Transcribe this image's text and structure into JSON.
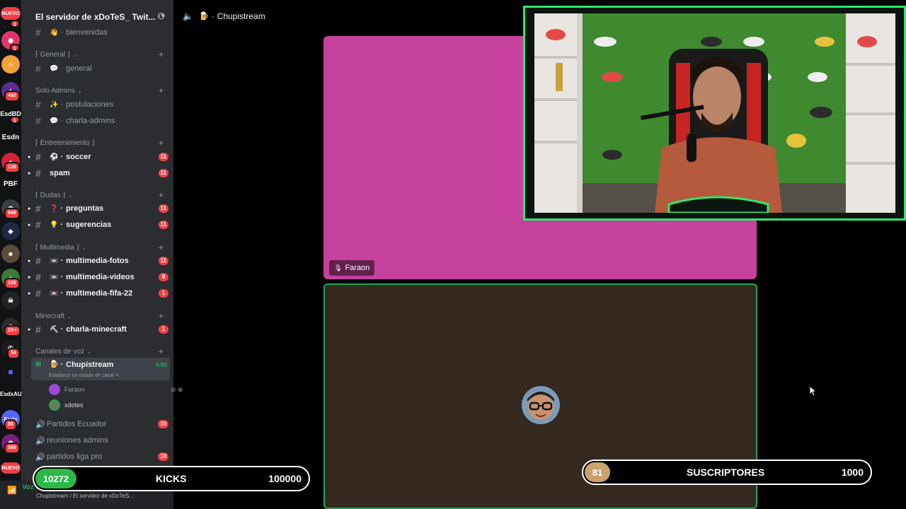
{
  "server_rail": {
    "nuevo_top": "NUEVO",
    "badges": [
      "1",
      "1",
      "480",
      "1",
      "136",
      "949",
      "106",
      "1K+",
      "34",
      "86",
      "389"
    ],
    "labels": [
      "EsdBD",
      "Esdn",
      "PBF",
      "EsdxAU",
      "Esdx"
    ],
    "nuevo_bottom": "NUEVO"
  },
  "server": {
    "name": "El servidor de xDoTeS_ Twit..."
  },
  "channels": {
    "bienvenidas": {
      "label": "bienvenidas",
      "emoji": "👋"
    },
    "cat_general": "⌈ General ⌋",
    "general": {
      "label": "general",
      "emoji": "💬"
    },
    "cat_solo_admins": "Solo Admins",
    "postulaciones": {
      "label": "postulaciones",
      "emoji": "✨"
    },
    "charla_admins": {
      "label": "charla-admins",
      "emoji": "💬"
    },
    "cat_entretenimiento": "⌈ Entretenimiento ⌋",
    "soccer": {
      "label": "soccer",
      "emoji": "⚽",
      "badge": "11"
    },
    "spam": {
      "label": "spam",
      "badge": "11"
    },
    "cat_dudas": "⌈ Dudas ⌋",
    "preguntas": {
      "label": "preguntas",
      "emoji": "❓",
      "badge": "11"
    },
    "sugerencias": {
      "label": "sugerencias",
      "emoji": "💡",
      "badge": "11"
    },
    "cat_multimedia": "⌈ Multimedia ⌋",
    "multimedia_fotos": {
      "label": "multimedia-fotos",
      "emoji": "📼",
      "badge": "11"
    },
    "multimedia_videos": {
      "label": "multimedia-videos",
      "emoji": "📼",
      "badge": "9"
    },
    "multimedia_fifa": {
      "label": "multimedia-fifa-22",
      "emoji": "📼",
      "badge": "1"
    },
    "cat_minecraft": "Minecraft",
    "charla_minecraft": {
      "label": "charla-minecraft",
      "emoji": "⛏",
      "badge": "1"
    },
    "cat_voz": "Canales de voz",
    "chupistream": {
      "label": "Chupistream",
      "emoji": "🍺",
      "time": "9:50",
      "status": "Establece un estado de canal"
    },
    "voice_users": [
      {
        "name": "Faraon"
      },
      {
        "name": "xdotes"
      }
    ],
    "partidos_ecuador": {
      "label": "Partidos Ecuador",
      "badge": "10"
    },
    "reuniones_admins": {
      "label": "reuniones admins"
    },
    "partidos_liga_pro": {
      "label": "partidos liga pro",
      "badge": "10"
    }
  },
  "voice_panel": {
    "status": "Voz conectada",
    "subtitle": "Chupistream / El servidor de xDoTeS..."
  },
  "stage": {
    "channel_title": "Chupistream",
    "channel_emoji": "🍺",
    "tile1_name": "Faraon",
    "colors": {
      "tile1": "#c6419e",
      "tile2": "#34281f",
      "speaking": "#23a55a"
    }
  },
  "overlays": {
    "kicks": {
      "current": "10272",
      "label": "KICKS",
      "target": "100000",
      "color": "#2db84a"
    },
    "subs": {
      "current": "81",
      "label": "SUSCRIPTORES",
      "target": "1000",
      "color": "#c9a36b"
    }
  }
}
